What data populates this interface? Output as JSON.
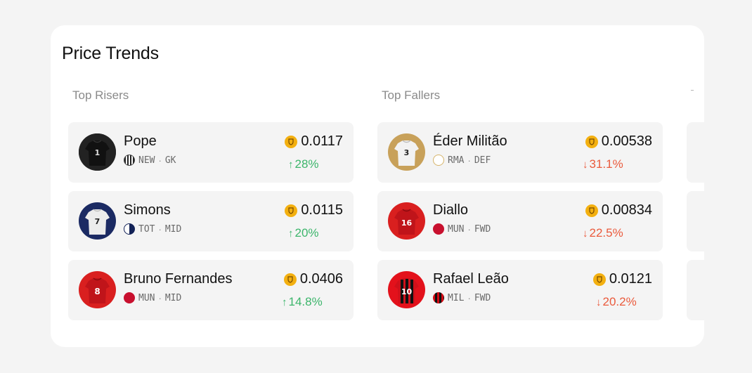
{
  "page": {
    "title": "Price Trends"
  },
  "risers": {
    "title": "Top Risers",
    "players": [
      {
        "name": "Pope",
        "club": "NEW",
        "position": "GK",
        "price": "0.0117",
        "change": "28%",
        "arrow": "↑"
      },
      {
        "name": "Simons",
        "club": "TOT",
        "position": "MID",
        "price": "0.0115",
        "change": "20%",
        "arrow": "↑"
      },
      {
        "name": "Bruno Fernandes",
        "club": "MUN",
        "position": "MID",
        "price": "0.0406",
        "change": "14.8%",
        "arrow": "↑"
      }
    ]
  },
  "fallers": {
    "title": "Top Fallers",
    "players": [
      {
        "name": "Éder Militão",
        "club": "RMA",
        "position": "DEF",
        "price": "0.00538",
        "change": "31.1%",
        "arrow": "↓"
      },
      {
        "name": "Diallo",
        "club": "MUN",
        "position": "FWD",
        "price": "0.00834",
        "change": "22.5%",
        "arrow": "↓"
      },
      {
        "name": "Rafael Leão",
        "club": "MIL",
        "position": "FWD",
        "price": "0.0121",
        "change": "20.2%",
        "arrow": "↓"
      }
    ]
  },
  "meta_separator": "·",
  "colors": {
    "up": "#3cb56b",
    "down": "#ea5a3c",
    "coin": "#f3b010",
    "row_bg": "#f4f4f4"
  }
}
